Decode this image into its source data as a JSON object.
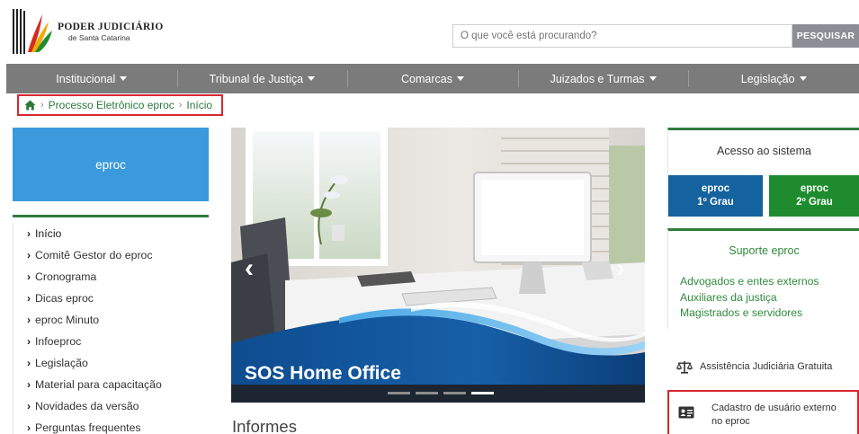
{
  "header": {
    "logo_line1": "PODER JUDICIÁRIO",
    "logo_line2": "de Santa Catarina",
    "search_placeholder": "O que você está procurando?",
    "search_button": "PESQUISAR"
  },
  "nav": {
    "items": [
      "Institucional",
      "Tribunal de Justiça",
      "Comarcas",
      "Juizados e Turmas",
      "Legislação"
    ]
  },
  "breadcrumb": {
    "items": [
      "Processo Eletrônico eproc",
      "Início"
    ]
  },
  "sidebar": {
    "title": "eproc",
    "items": [
      "Início",
      "Comitê Gestor do eproc",
      "Cronograma",
      "Dicas eproc",
      "eproc Minuto",
      "Infoeproc",
      "Legislação",
      "Material para capacitação",
      "Novidades da versão",
      "Perguntas frequentes"
    ]
  },
  "carousel": {
    "slide_title": "SOS Home Office",
    "indicator_count": 4,
    "active_indicator": 4
  },
  "main": {
    "section_title": "Informes"
  },
  "access": {
    "title": "Acesso ao sistema",
    "btn1_line1": "eproc",
    "btn1_line2": "1º Grau",
    "btn2_line1": "eproc",
    "btn2_line2": "2º Grau"
  },
  "support": {
    "title": "Suporte eproc",
    "links": [
      "Advogados e entes externos",
      "Auxiliares da justiça",
      "Magistrados e servidores"
    ]
  },
  "quick_links": {
    "assist": "Assistência Judiciária Gratuita",
    "cadastro_line1": "Cadastro de usuário externo",
    "cadastro_line2": "no eproc"
  },
  "colors": {
    "nav_bg": "#7b7b7b",
    "accent_green": "#2e7d3c",
    "eproc_blue": "#3a9adc",
    "btn1_blue": "#14629e",
    "btn2_green": "#1e8c2e",
    "highlight_red": "#d8262f"
  }
}
